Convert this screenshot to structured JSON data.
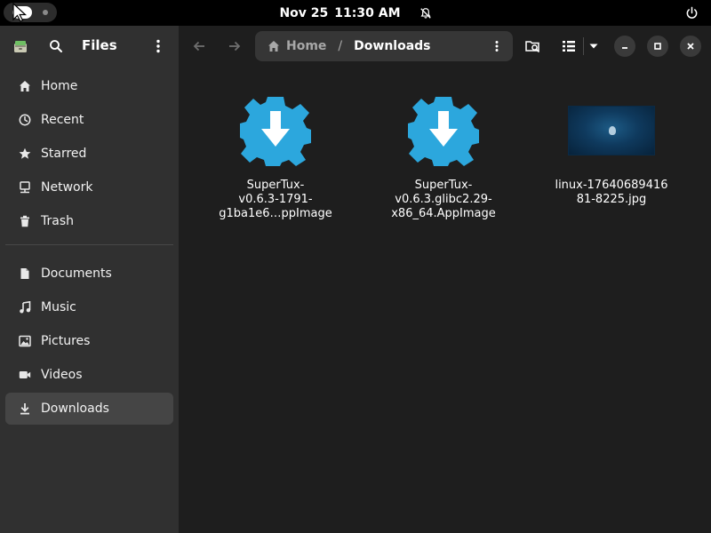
{
  "topbar": {
    "date": "Nov 25",
    "time": "11:30 AM",
    "icons": [
      "activities-indicator",
      "bell-off-icon",
      "power-icon"
    ]
  },
  "sidebar": {
    "title": "Files",
    "header_icons": [
      "files-app-icon",
      "search-icon",
      "kebab-menu-icon"
    ],
    "places": [
      {
        "label": "Home",
        "icon": "home-icon"
      },
      {
        "label": "Recent",
        "icon": "clock-icon"
      },
      {
        "label": "Starred",
        "icon": "star-icon"
      },
      {
        "label": "Network",
        "icon": "network-icon"
      },
      {
        "label": "Trash",
        "icon": "trash-icon"
      }
    ],
    "bookmarks": [
      {
        "label": "Documents",
        "icon": "document-icon"
      },
      {
        "label": "Music",
        "icon": "music-icon"
      },
      {
        "label": "Pictures",
        "icon": "picture-icon"
      },
      {
        "label": "Videos",
        "icon": "video-icon"
      },
      {
        "label": "Downloads",
        "icon": "download-icon",
        "active": true
      }
    ]
  },
  "header": {
    "breadcrumb": {
      "home": "Home",
      "separator": "/",
      "current": "Downloads"
    },
    "icons": [
      "back-icon",
      "forward-icon",
      "path-menu-icon",
      "search-folder-icon",
      "list-view-icon",
      "view-options-icon",
      "minimize-icon",
      "maximize-icon",
      "close-icon"
    ]
  },
  "files": [
    {
      "name_lines": [
        "SuperTux-",
        "v0.6.3-1791-",
        "g1ba1e6…ppImage"
      ],
      "type": "appimage",
      "icon": "download-package-icon"
    },
    {
      "name_lines": [
        "SuperTux-",
        "v0.6.3.glibc2.29-",
        "x86_64.AppImage"
      ],
      "type": "appimage",
      "icon": "download-package-icon"
    },
    {
      "name_lines": [
        "linux-17640689416",
        "81-8225.jpg"
      ],
      "type": "image",
      "icon": "image-thumbnail"
    }
  ],
  "colors": {
    "topbar_bg": "#000000",
    "sidebar_bg": "#303030",
    "main_bg": "#1e1e1e",
    "active_item_bg": "#454545",
    "pathbar_bg": "#363636",
    "appimage_icon": "#2ca7dd"
  }
}
